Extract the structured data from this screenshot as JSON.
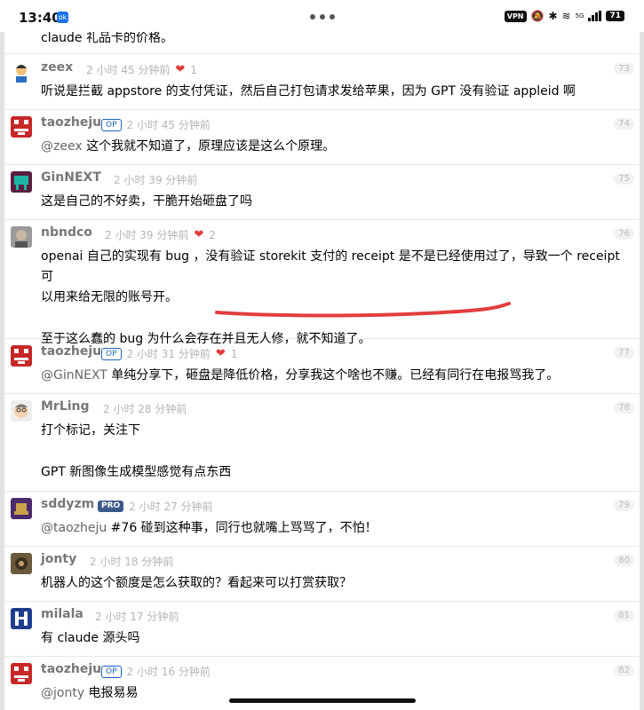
{
  "status_bar": {
    "time": "13:40",
    "app_icon": "ok",
    "vpn": "VPN",
    "battery": "71",
    "network": "5G"
  },
  "top_text": "claude 礼品卡的价格。",
  "posts": [
    {
      "user": "zeex",
      "time": "2 小时 45 分钟前",
      "likes": "1",
      "floor": "73",
      "op": false,
      "pro": false,
      "lines": [
        "听说是拦截 appstore 的支付凭证，然后自己打包请求发给苹果，因为 GPT 没有验证 appleid 啊"
      ]
    },
    {
      "user": "taozheju",
      "time": "2 小时 45 分钟前",
      "likes": "",
      "floor": "74",
      "op": true,
      "pro": false,
      "mention": "@zeex",
      "lines": [
        " 这个我就不知道了，原理应该是这么个原理。"
      ]
    },
    {
      "user": "GinNEXT",
      "time": "2 小时 39 分钟前",
      "likes": "",
      "floor": "75",
      "op": false,
      "pro": false,
      "lines": [
        "这是自己的不好卖，干脆开始砸盘了吗"
      ]
    },
    {
      "user": "nbndco",
      "time": "2 小时 39 分钟前",
      "likes": "2",
      "floor": "76",
      "op": false,
      "pro": false,
      "lines": [
        "openai 自己的实现有 bug ，没有验证 storekit 支付的 receipt 是不是已经使用过了，导致一个 receipt 可",
        "以用来给无限的账号开。",
        "",
        "至于这么蠢的 bug 为什么会存在并且无人修，就不知道了。"
      ]
    },
    {
      "user": "taozheju",
      "time": "2 小时 31 分钟前",
      "likes": "1",
      "floor": "77",
      "op": true,
      "pro": false,
      "mention": "@GinNEXT",
      "lines": [
        " 单纯分享下，砸盘是降低价格，分享我这个啥也不赚。已经有同行在电报骂我了。"
      ]
    },
    {
      "user": "MrLing",
      "time": "2 小时 28 分钟前",
      "likes": "",
      "floor": "78",
      "op": false,
      "pro": false,
      "lines": [
        "打个标记，关注下",
        "",
        "GPT 新图像生成模型感觉有点东西"
      ]
    },
    {
      "user": "sddyzm",
      "time": "2 小时 27 分钟前",
      "likes": "",
      "floor": "79",
      "op": false,
      "pro": true,
      "mention": "@taozheju",
      "lines": [
        " #76 碰到这种事，同行也就嘴上骂骂了，不怕！"
      ]
    },
    {
      "user": "jonty",
      "time": "2 小时 18 分钟前",
      "likes": "",
      "floor": "80",
      "op": false,
      "pro": false,
      "lines": [
        "机器人的这个额度是怎么获取的？看起来可以打赏获取？"
      ]
    },
    {
      "user": "milala",
      "time": "2 小时 17 分钟前",
      "likes": "",
      "floor": "81",
      "op": false,
      "pro": false,
      "lines": [
        "有 claude 源头吗"
      ]
    },
    {
      "user": "taozheju",
      "time": "2 小时 16 分钟前",
      "likes": "",
      "floor": "82",
      "op": true,
      "pro": false,
      "mention": "@jonty",
      "lines": [
        " 电报易易"
      ]
    }
  ],
  "badges": {
    "op": "OP",
    "pro": "PRO"
  },
  "colors": {
    "accent": "#1a64c0",
    "heart": "#e23d3d",
    "underline": "#e23d3d"
  }
}
